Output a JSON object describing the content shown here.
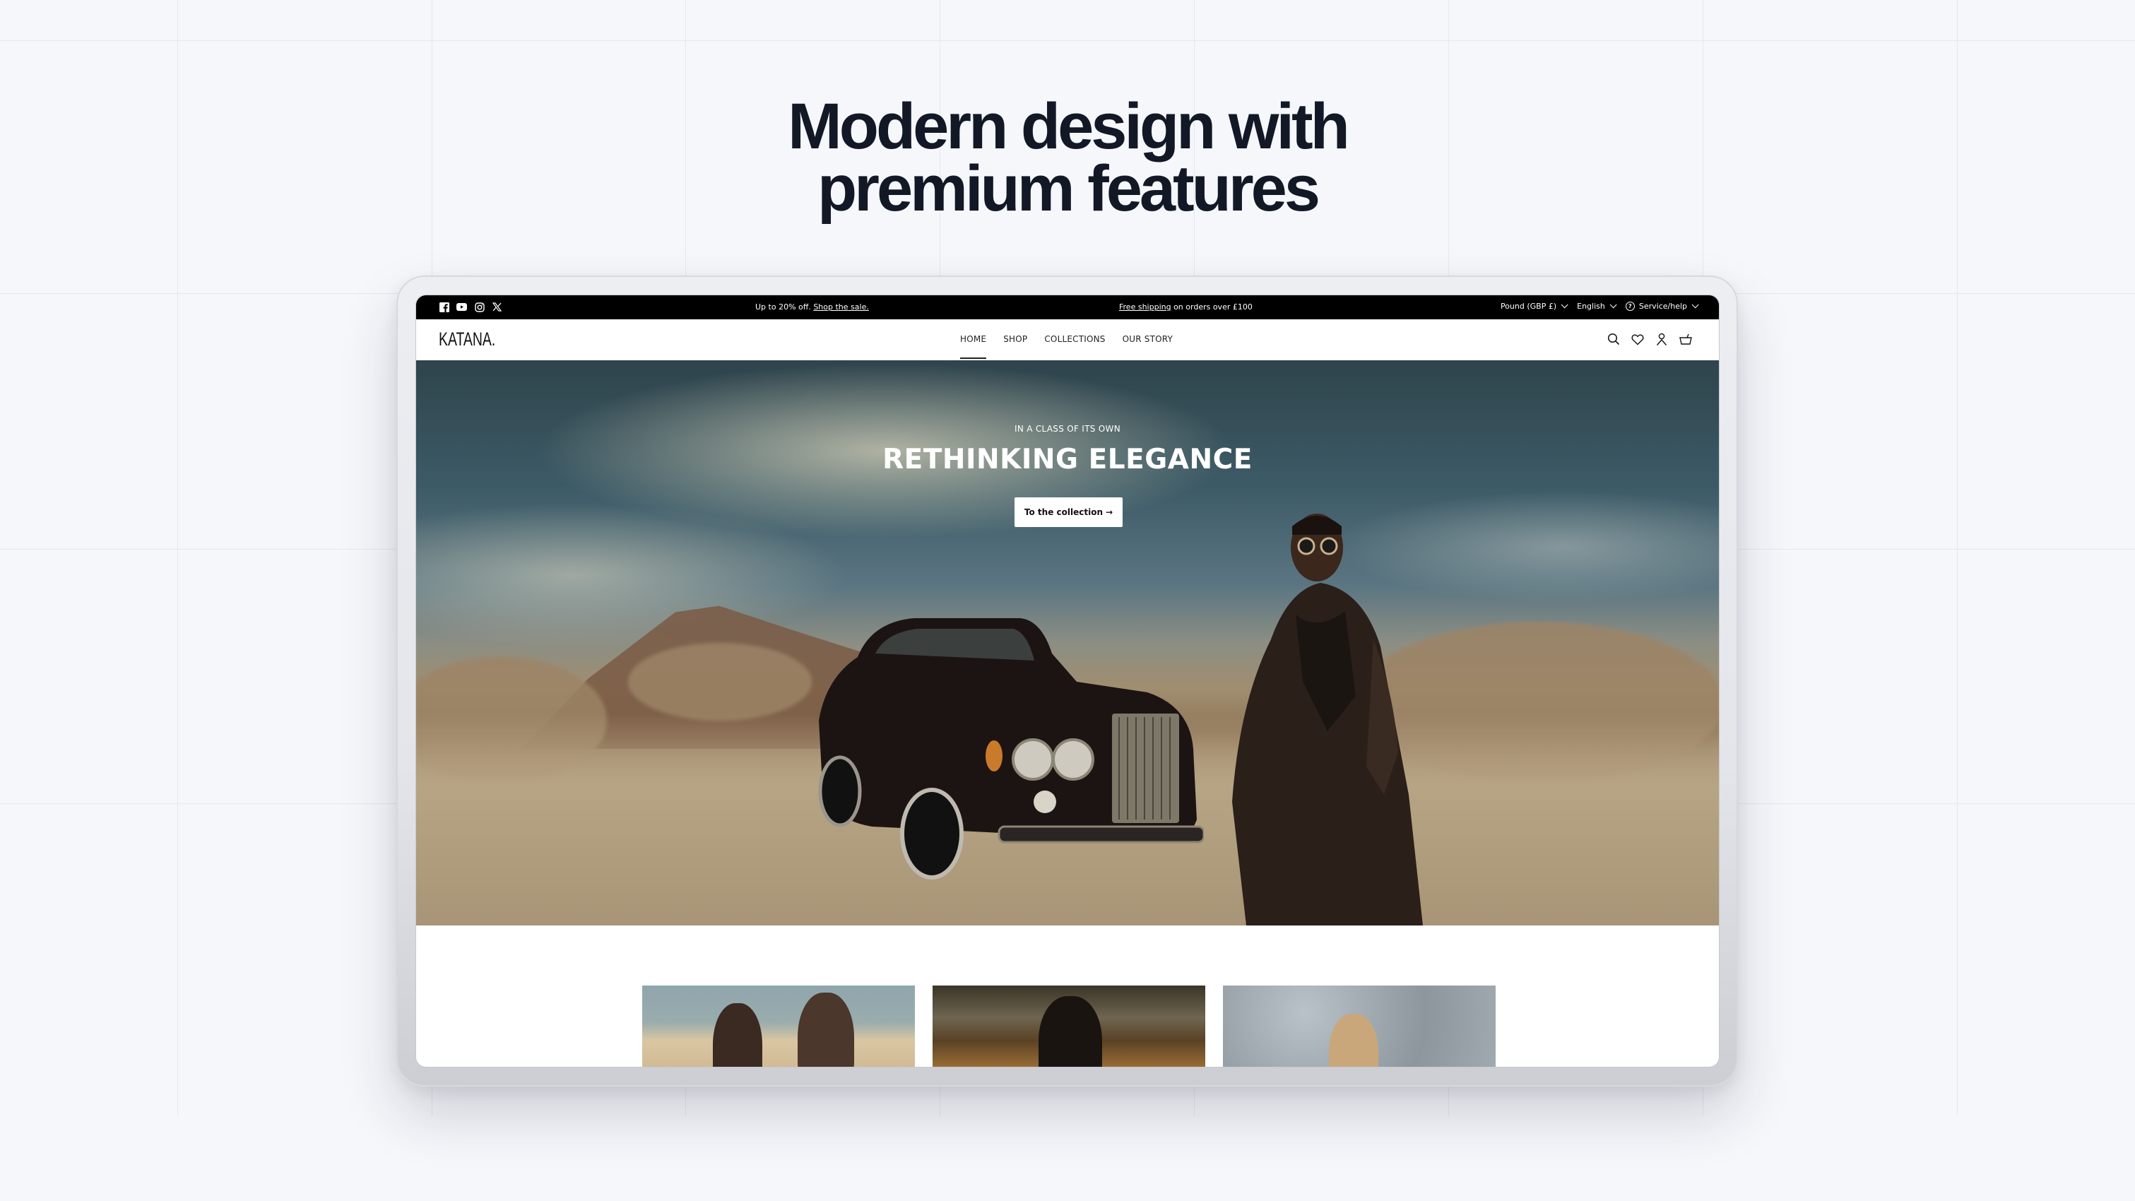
{
  "headline": {
    "line1": "Modern design with",
    "line2": "premium features"
  },
  "topbar": {
    "socials": [
      {
        "name": "facebook-icon",
        "glyph": "f"
      },
      {
        "name": "youtube-icon",
        "glyph": "▶"
      },
      {
        "name": "instagram-icon",
        "glyph": "◎"
      },
      {
        "name": "x-icon",
        "glyph": "𝕏"
      }
    ],
    "promo1_text": "Up to 20% off. ",
    "promo1_link": "Shop the sale.",
    "promo2_link": "Free shipping",
    "promo2_text": " on orders over £100",
    "currency": "Pound (GBP £)",
    "language": "English",
    "help": "Service/help",
    "help_glyph": "?"
  },
  "nav": {
    "logo": "KATANA.",
    "links": [
      {
        "label": "HOME",
        "active": true
      },
      {
        "label": "SHOP",
        "active": false
      },
      {
        "label": "COLLECTIONS",
        "active": false
      },
      {
        "label": "OUR STORY",
        "active": false
      }
    ],
    "icons": [
      "search-icon",
      "wishlist-heart-icon",
      "account-icon",
      "cart-basket-icon"
    ]
  },
  "hero": {
    "eyebrow": "IN A CLASS OF ITS OWN",
    "title": "RETHINKING ELEGANCE",
    "cta_label": "To the collection",
    "cta_arrow": "→"
  },
  "colors": {
    "background": "#f5f7fb",
    "headline": "#131826",
    "topbar": "#000000",
    "nav_bg": "#ffffff"
  }
}
